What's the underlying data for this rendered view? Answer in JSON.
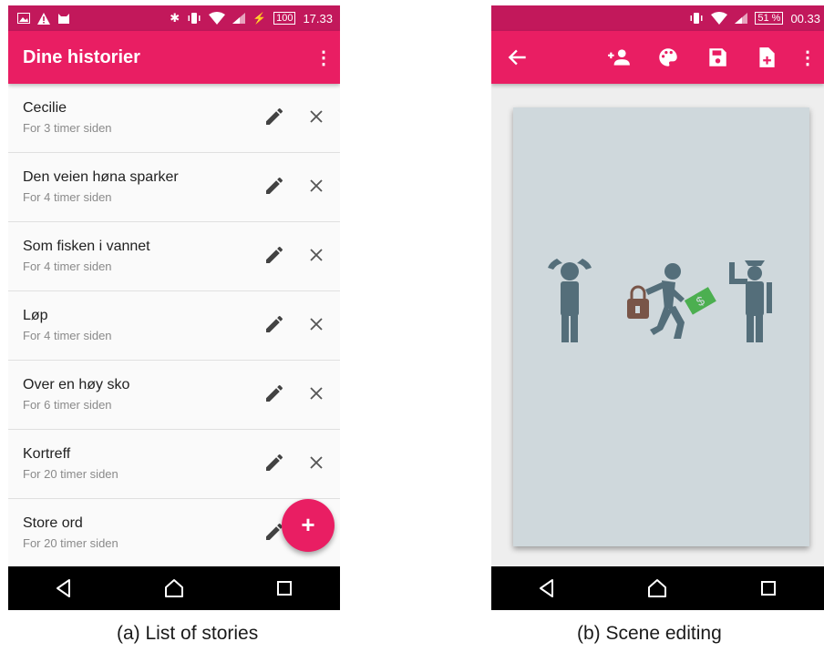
{
  "screen_a": {
    "status": {
      "battery": "100",
      "time": "17.33"
    },
    "title": "Dine historier",
    "stories": [
      {
        "title": "Cecilie",
        "subtitle": "For 3 timer siden"
      },
      {
        "title": "Den veien høna sparker",
        "subtitle": "For 4 timer siden"
      },
      {
        "title": "Som fisken i vannet",
        "subtitle": "For 4 timer siden"
      },
      {
        "title": "Løp",
        "subtitle": "For 4 timer siden"
      },
      {
        "title": "Over en høy sko",
        "subtitle": "For 6 timer siden"
      },
      {
        "title": "Kortreff",
        "subtitle": "For 20 timer siden"
      },
      {
        "title": "Store ord",
        "subtitle": "For 20 timer siden"
      }
    ],
    "fab_label": "+",
    "caption": "(a) List of stories"
  },
  "screen_b": {
    "status": {
      "battery": "51 %",
      "time": "00.33"
    },
    "toolbar_icons": [
      "back-arrow-icon",
      "add-person-icon",
      "palette-icon",
      "save-icon",
      "new-file-icon",
      "overflow-menu-icon"
    ],
    "money_symbol": "$",
    "caption": "(b) Scene editing"
  },
  "colors": {
    "primary": "#e91e63",
    "status_bar": "#c2185b",
    "canvas": "#cfd8dc",
    "figure": "#546e7a",
    "money": "#4caf50",
    "bag": "#795548"
  }
}
